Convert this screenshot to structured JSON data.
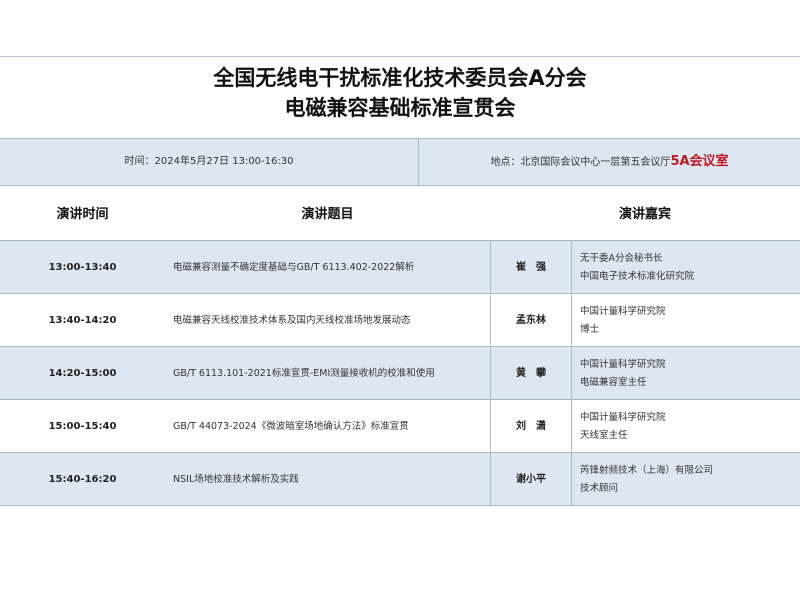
{
  "header": {
    "title_line1": "全国无线电干扰标准化技术委员会A分会",
    "title_line2": "电磁兼容基础标准宣贯会"
  },
  "info": {
    "time": "时间：2024年5月27日 13:00-16:30",
    "place_prefix": "地点：北京国际会议中心一层第五会议厅",
    "place_room": "5A会议室"
  },
  "table": {
    "headers": {
      "time": "演讲时间",
      "topic": "演讲题目",
      "speaker": "演讲嘉宾"
    },
    "rows": [
      {
        "time": "13:00-13:40",
        "topic": "电磁兼容测量不确定度基础与GB/T 6113.402-2022解析",
        "name": "崔　强",
        "org1": "无干委A分会秘书长",
        "org2": "中国电子技术标准化研究院"
      },
      {
        "time": "13:40-14:20",
        "topic": "电磁兼容天线校准技术体系及国内天线校准场地发展动态",
        "name": "孟东林",
        "org1": "中国计量科学研究院",
        "org2": "博士"
      },
      {
        "time": "14:20-15:00",
        "topic": "GB/T 6113.101-2021标准宣贯-EMI测量接收机的校准和使用",
        "name": "黄　攀",
        "org1": "中国计量科学研究院",
        "org2": "电磁兼容室主任"
      },
      {
        "time": "15:00-15:40",
        "topic": "GB/T 44073-2024《微波暗室场地确认方法》标准宣贯",
        "name": "刘　潇",
        "org1": "中国计量科学研究院",
        "org2": "天线室主任"
      },
      {
        "time": "15:40-16:20",
        "topic": "NSIL场地校准技术解析及实践",
        "name": "谢小平",
        "org1": "芮锋射频技术（上海）有限公司",
        "org2": "技术顾问"
      }
    ]
  },
  "colors": {
    "band": "#dde7f1",
    "room_accent": "#c0171f",
    "rule": "#a9b7c7"
  }
}
